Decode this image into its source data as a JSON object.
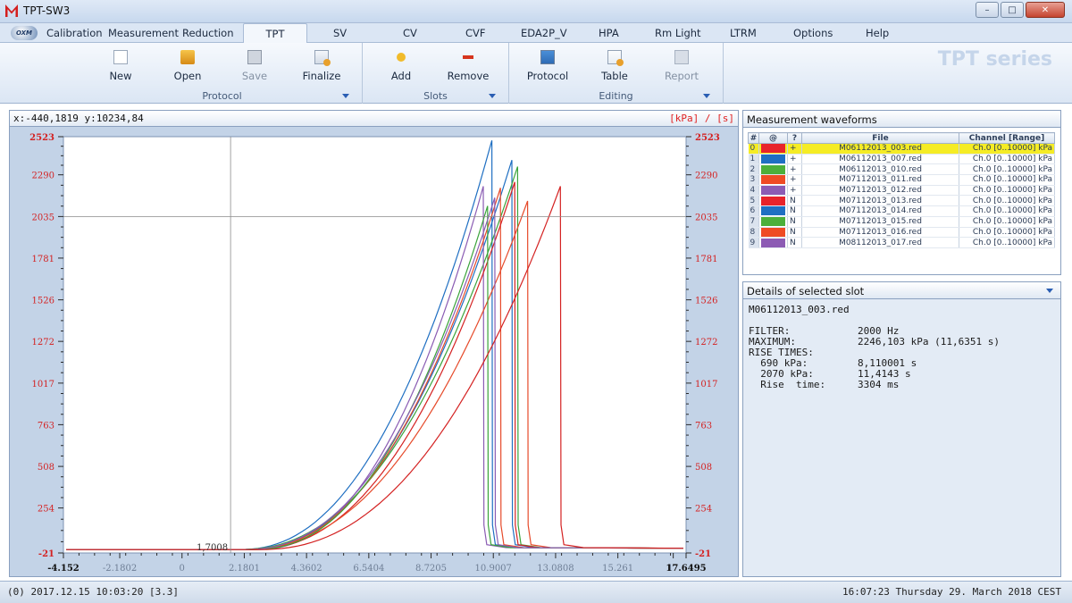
{
  "window": {
    "title": "TPT-SW3",
    "minimize_glyph": "–",
    "maximize_glyph": "□",
    "close_glyph": "✕"
  },
  "app": {
    "orb_label": "OXM"
  },
  "menu": {
    "tabs": [
      "Calibration",
      "Measurement",
      "Reduction",
      "TPT",
      "SV",
      "CV",
      "CVF",
      "EDA2P_V",
      "HPA",
      "Rm Light",
      "LTRM",
      "Options",
      "Help"
    ],
    "active": "TPT"
  },
  "ribbon": {
    "groups": [
      {
        "label": "Protocol",
        "buttons": [
          {
            "label": "New",
            "icon": "new-document-icon",
            "enabled": true
          },
          {
            "label": "Open",
            "icon": "open-folder-icon",
            "enabled": true
          },
          {
            "label": "Save",
            "icon": "save-disk-icon",
            "enabled": false
          },
          {
            "label": "Finalize",
            "icon": "finalize-icon",
            "enabled": true
          }
        ]
      },
      {
        "label": "Slots",
        "buttons": [
          {
            "label": "Add",
            "icon": "add-icon",
            "enabled": true
          },
          {
            "label": "Remove",
            "icon": "remove-icon",
            "enabled": true
          }
        ]
      },
      {
        "label": "Editing",
        "buttons": [
          {
            "label": "Protocol",
            "icon": "protocol-icon",
            "enabled": true
          },
          {
            "label": "Table",
            "icon": "table-icon",
            "enabled": true
          },
          {
            "label": "Report",
            "icon": "report-icon",
            "enabled": false
          }
        ]
      }
    ],
    "brand": "TPT series"
  },
  "chart": {
    "coord_readout": "x:-440,1819 y:10234,84",
    "units": "[kPa] / [s]",
    "cursor_label": "1,7008",
    "x_ticks": [
      "-4.152",
      "-2.1802",
      "0",
      "2.1801",
      "4.3602",
      "6.5404",
      "8.7205",
      "10.9007",
      "13.0808",
      "15.261",
      "1",
      "17.6495"
    ],
    "y_ticks": [
      "2523",
      "2290",
      "2035",
      "1781",
      "1526",
      "1272",
      "1017",
      "763",
      "508",
      "254",
      "-21"
    ]
  },
  "chart_data": {
    "type": "line",
    "title": "",
    "xlabel": "",
    "ylabel": "",
    "xlim": [
      -4.152,
      17.6495
    ],
    "ylim": [
      -21,
      2523
    ],
    "cursor": {
      "x": 1.7008,
      "y": 2035
    },
    "series": [
      {
        "color": "#1f6fc2",
        "onset": 2.0,
        "peak_x": 10.85,
        "peak_y": 2500
      },
      {
        "color": "#1f6fc2",
        "onset": 2.2,
        "peak_x": 11.55,
        "peak_y": 2380
      },
      {
        "color": "#3aa33a",
        "onset": 2.0,
        "peak_x": 11.75,
        "peak_y": 2340
      },
      {
        "color": "#8a5cb3",
        "onset": 2.6,
        "peak_x": 10.55,
        "peak_y": 2220
      },
      {
        "color": "#e64a2a",
        "onset": 2.3,
        "peak_x": 11.15,
        "peak_y": 2210
      },
      {
        "color": "#d42222",
        "onset": 2.4,
        "peak_x": 11.65,
        "peak_y": 2246
      },
      {
        "color": "#e64a2a",
        "onset": 2.1,
        "peak_x": 12.1,
        "peak_y": 2130
      },
      {
        "color": "#3aa33a",
        "onset": 2.5,
        "peak_x": 10.7,
        "peak_y": 2100
      },
      {
        "color": "#8a5cb3",
        "onset": 2.2,
        "peak_x": 10.95,
        "peak_y": 2150
      },
      {
        "color": "#d42222",
        "onset": 2.7,
        "peak_x": 13.25,
        "peak_y": 2220
      }
    ]
  },
  "waveforms": {
    "title": "Measurement waveforms",
    "columns": [
      "#",
      "@",
      "?",
      "File",
      "Channel [Range]"
    ],
    "rows": [
      {
        "idx": "0",
        "color": "#e8232a",
        "flag": "+",
        "file": "M06112013_003.red",
        "channel": "Ch.0 [0..10000] kPa",
        "selected": true
      },
      {
        "idx": "1",
        "color": "#1f6fc2",
        "flag": "+",
        "file": "M06112013_007.red",
        "channel": "Ch.0 [0..10000] kPa",
        "selected": false
      },
      {
        "idx": "2",
        "color": "#4caf3a",
        "flag": "+",
        "file": "M06112013_010.red",
        "channel": "Ch.0 [0..10000] kPa",
        "selected": false
      },
      {
        "idx": "3",
        "color": "#ef4b24",
        "flag": "+",
        "file": "M07112013_011.red",
        "channel": "Ch.0 [0..10000] kPa",
        "selected": false
      },
      {
        "idx": "4",
        "color": "#8c5bb4",
        "flag": "+",
        "file": "M07112013_012.red",
        "channel": "Ch.0 [0..10000] kPa",
        "selected": false
      },
      {
        "idx": "5",
        "color": "#e8232a",
        "flag": "N",
        "file": "M07112013_013.red",
        "channel": "Ch.0 [0..10000] kPa",
        "selected": false
      },
      {
        "idx": "6",
        "color": "#1f6fc2",
        "flag": "N",
        "file": "M07112013_014.red",
        "channel": "Ch.0 [0..10000] kPa",
        "selected": false
      },
      {
        "idx": "7",
        "color": "#4caf3a",
        "flag": "N",
        "file": "M07112013_015.red",
        "channel": "Ch.0 [0..10000] kPa",
        "selected": false
      },
      {
        "idx": "8",
        "color": "#ef4b24",
        "flag": "N",
        "file": "M07112013_016.red",
        "channel": "Ch.0 [0..10000] kPa",
        "selected": false
      },
      {
        "idx": "9",
        "color": "#8c5bb4",
        "flag": "N",
        "file": "M08112013_017.red",
        "channel": "Ch.0 [0..10000] kPa",
        "selected": false
      }
    ]
  },
  "details": {
    "title": "Details of selected slot",
    "file": "M06112013_003.red",
    "rows": [
      {
        "label": "FILTER:",
        "value": "2000 Hz"
      },
      {
        "label": "MAXIMUM:",
        "value": "2246,103 kPa (11,6351 s)"
      },
      {
        "label": "RISE TIMES:",
        "value": ""
      },
      {
        "label": "  690 kPa:",
        "value": "8,110001 s"
      },
      {
        "label": "  2070 kPa:",
        "value": "11,4143 s"
      },
      {
        "label": "  Rise  time:",
        "value": "3304 ms"
      }
    ]
  },
  "status": {
    "left": "(0) 2017.12.15 10:03:20 [3.3]",
    "right": "16:07:23 Thursday 29. March 2018 CEST"
  }
}
